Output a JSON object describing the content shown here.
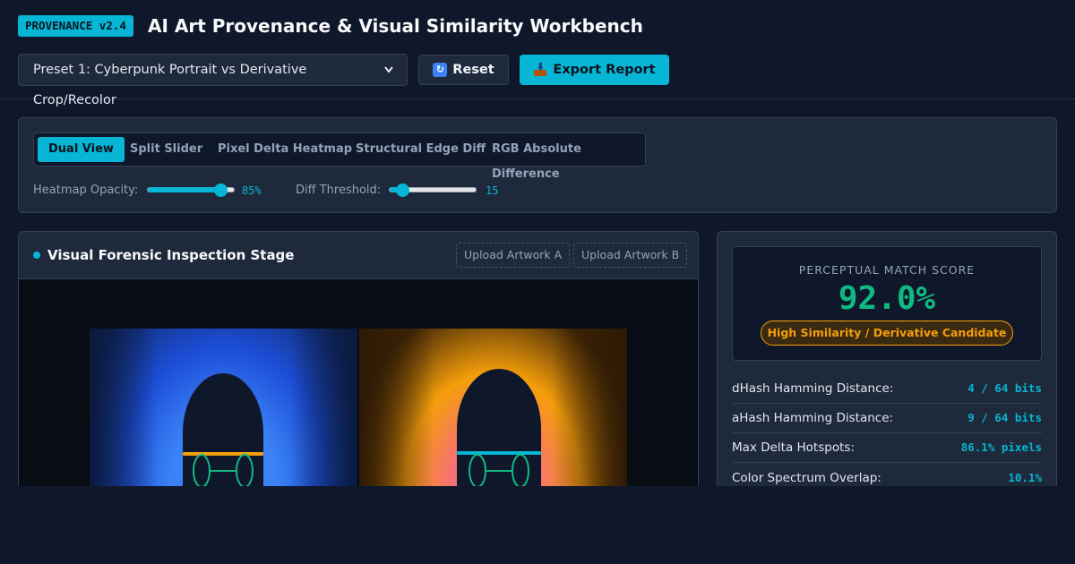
{
  "header": {
    "badge": "PROVENANCE v2.4",
    "title": "AI Art Provenance & Visual Similarity Workbench",
    "preset_selected": "Preset 1: Cyberpunk Portrait vs Derivative Crop/Recolor",
    "reset_label": "Reset",
    "export_label": "Export Report",
    "reset_icon": "refresh-icon",
    "export_icon": "inbox-tray-icon"
  },
  "toolbar": {
    "tabs": [
      {
        "label": "Dual View",
        "active": true
      },
      {
        "label": "Split Slider",
        "active": false
      },
      {
        "label": "Pixel Delta Heatmap",
        "active": false
      },
      {
        "label": "Structural Edge Diff",
        "active": false
      },
      {
        "label": "RGB Absolute Difference",
        "active": false
      }
    ],
    "heatmap_opacity": {
      "label": "Heatmap Opacity:",
      "value": 85,
      "display": "85%",
      "min": 0,
      "max": 100
    },
    "diff_threshold": {
      "label": "Diff Threshold:",
      "value": 15,
      "display": "15",
      "min": 0,
      "max": 100
    }
  },
  "stage": {
    "title": "Visual Forensic Inspection Stage",
    "upload_a": "Upload Artwork A",
    "upload_b": "Upload Artwork B"
  },
  "metrics": {
    "score_label": "PERCEPTUAL MATCH SCORE",
    "score_value": "92.0%",
    "verdict": "High Similarity / Derivative Candidate",
    "rows": [
      {
        "label": "dHash Hamming Distance:",
        "value": "4 / 64 bits"
      },
      {
        "label": "aHash Hamming Distance:",
        "value": "9 / 64 bits"
      },
      {
        "label": "Max Delta Hotspots:",
        "value": "86.1% pixels"
      },
      {
        "label": "Color Spectrum Overlap:",
        "value": "10.1%"
      }
    ]
  },
  "colors": {
    "accent": "#06b6d4",
    "score": "#10b981",
    "warning": "#f59e0b",
    "background": "#0f172a"
  }
}
